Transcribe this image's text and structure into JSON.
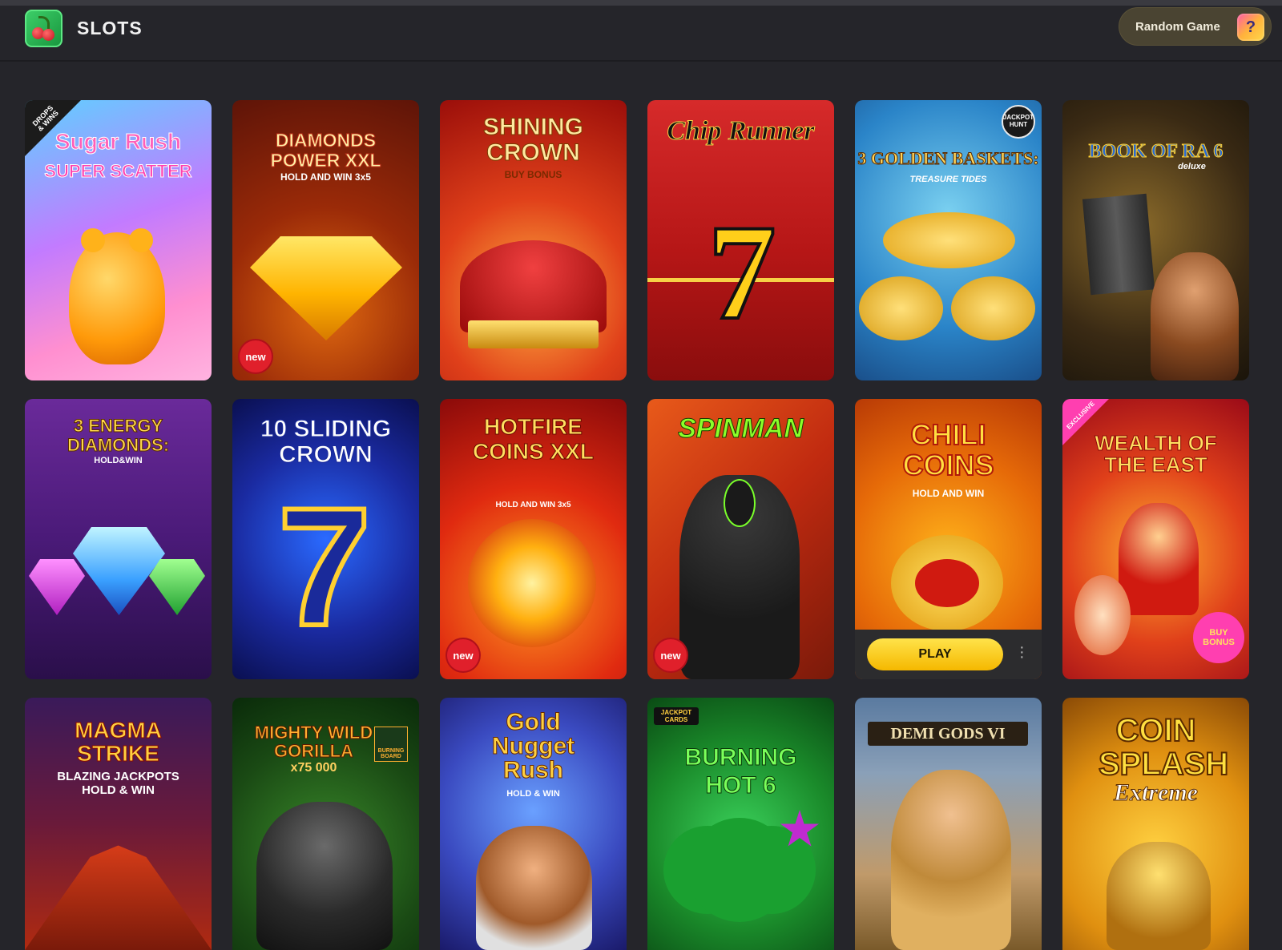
{
  "header": {
    "title": "SLOTS",
    "random_label": "Random Game",
    "random_icon": "dice-icon"
  },
  "games": [
    {
      "name_line1": "Sugar Rush",
      "name_line2": "SUPER SCATTER",
      "corner": "DROPS & WINS",
      "new": false
    },
    {
      "name_line1": "DIAMONDS POWER XXL",
      "name_line2": "HOLD AND WIN 3x5",
      "new": true
    },
    {
      "name_line1": "SHINING CROWN",
      "name_line2": "BUY BONUS",
      "new": false
    },
    {
      "name_line1": "Chip Runner",
      "new": false
    },
    {
      "name_line1": "3 GOLDEN BASKETS:",
      "name_line2": "TREASURE TIDES",
      "corner": "JACKPOT HUNT",
      "new": false
    },
    {
      "name_line1": "BOOK OF RA 6",
      "name_line2": "deluxe",
      "new": false
    },
    {
      "name_line1": "3 ENERGY DIAMONDS:",
      "name_line2": "HOLD&WIN",
      "new": false
    },
    {
      "name_line1": "10 SLIDING CROWN",
      "new": false
    },
    {
      "name_line1": "HOTFIRE COINS XXL",
      "name_line2": "HOLD AND WIN 3x5",
      "new": true
    },
    {
      "name_line1": "SPINMAN",
      "new": true
    },
    {
      "name_line1": "CHILI COINS",
      "name_line2": "HOLD AND WIN",
      "play_label": "PLAY",
      "new": false
    },
    {
      "name_line1": "WEALTH OF THE EAST",
      "corner": "EXCLUSIVE",
      "new": false,
      "buy": "BUY BONUS"
    },
    {
      "name_line1": "MAGMA STRIKE",
      "name_line2": "BLAZING JACKPOTS HOLD & WIN",
      "new": false
    },
    {
      "name_line1": "MIGHTY WILD GORILLA",
      "name_line2": "x75 000",
      "corner": "BURNING BOARD",
      "new": false
    },
    {
      "name_line1": "Gold Nugget Rush",
      "name_line2": "HOLD & WIN",
      "new": false
    },
    {
      "name_line1": "BURNING HOT 6",
      "corner": "JACKPOT CARDS",
      "new": false
    },
    {
      "name_line1": "DEMI GODS VI",
      "new": false
    },
    {
      "name_line1": "COIN SPLASH",
      "name_line2": "Extreme",
      "new": false
    }
  ],
  "badge_new": "new"
}
